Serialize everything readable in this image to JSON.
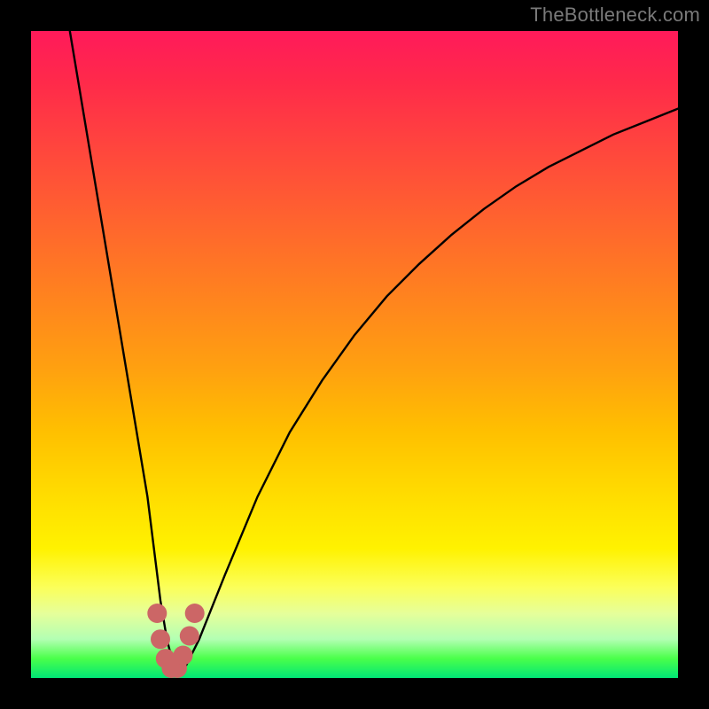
{
  "watermark": "TheBottleneck.com",
  "chart_data": {
    "type": "line",
    "title": "",
    "xlabel": "",
    "ylabel": "",
    "xlim": [
      0,
      100
    ],
    "ylim": [
      0,
      100
    ],
    "series": [
      {
        "name": "bottleneck-curve",
        "x": [
          6,
          8,
          10,
          12,
          14,
          16,
          18,
          19,
          20,
          21,
          22,
          23,
          24,
          26,
          30,
          35,
          40,
          45,
          50,
          55,
          60,
          65,
          70,
          75,
          80,
          85,
          90,
          95,
          100
        ],
        "values": [
          100,
          88,
          76,
          64,
          52,
          40,
          28,
          20,
          12,
          6,
          2,
          1,
          2,
          6,
          16,
          28,
          38,
          46,
          53,
          59,
          64,
          68.5,
          72.5,
          76,
          79,
          81.5,
          84,
          86,
          88
        ]
      }
    ],
    "markers": {
      "name": "highlight-points",
      "color": "#cc6666",
      "points": [
        {
          "x": 19.5,
          "y": 10
        },
        {
          "x": 20.0,
          "y": 6
        },
        {
          "x": 20.8,
          "y": 3
        },
        {
          "x": 21.7,
          "y": 1.5
        },
        {
          "x": 22.6,
          "y": 1.5
        },
        {
          "x": 23.5,
          "y": 3.5
        },
        {
          "x": 24.5,
          "y": 6.5
        },
        {
          "x": 25.3,
          "y": 10
        }
      ]
    },
    "gradient_stops": [
      {
        "pos": 0,
        "color": "#ff1a5a"
      },
      {
        "pos": 50,
        "color": "#ffa010"
      },
      {
        "pos": 80,
        "color": "#fff200"
      },
      {
        "pos": 100,
        "color": "#00e676"
      }
    ]
  }
}
